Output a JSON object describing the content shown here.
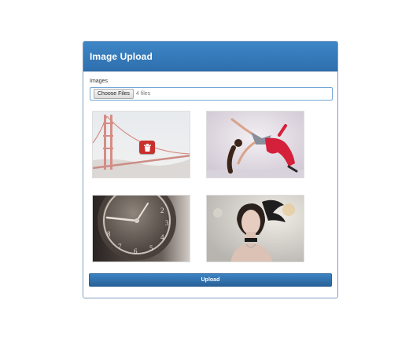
{
  "panel": {
    "title": "Image Upload"
  },
  "form": {
    "images_label": "Images",
    "choose_files_label": "Choose Files",
    "file_count_text": "4 files",
    "upload_label": "Upload"
  },
  "thumbnails": [
    {
      "subject": "golden-gate-bridge",
      "has_delete_button": true,
      "delete_icon": "trash-icon"
    },
    {
      "subject": "dancer"
    },
    {
      "subject": "clock"
    },
    {
      "subject": "woman-portrait"
    }
  ],
  "colors": {
    "header": "#2f6fae",
    "primary_button": "#2a6198",
    "delete_button": "#c9302c",
    "panel_border": "#7f9ec2"
  }
}
